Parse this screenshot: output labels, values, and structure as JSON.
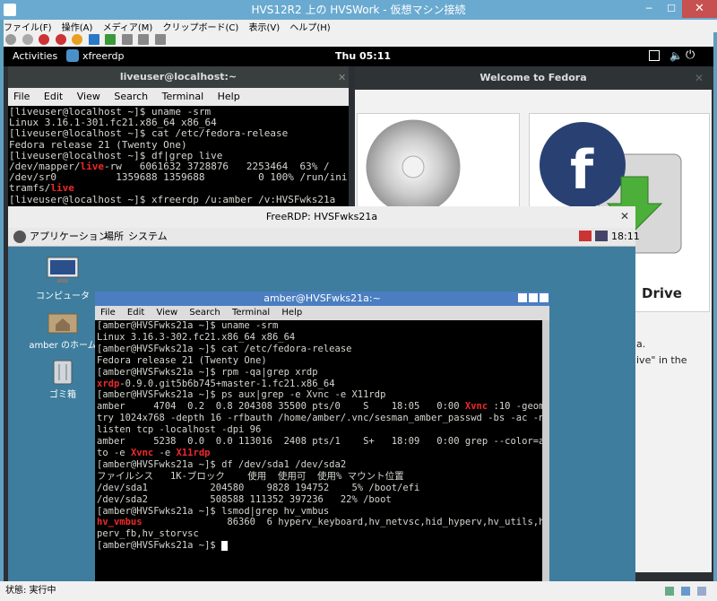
{
  "hyperv": {
    "title": "HVS12R2 上の HVSWork - 仮想マシン接続",
    "menu": [
      "ファイル(F)",
      "操作(A)",
      "メディア(M)",
      "クリップボード(C)",
      "表示(V)",
      "ヘルプ(H)"
    ],
    "status": "状態: 実行中",
    "close_glyph": "✕",
    "min_glyph": "─",
    "max_glyph": "☐"
  },
  "gnome": {
    "activities": "Activities",
    "app_name": "xfreerdp",
    "clock": "Thu 05:11"
  },
  "welcome": {
    "title": "Welcome to Fedora",
    "drive_text": "Drive",
    "text1": "a.",
    "text2": "ive\" in the"
  },
  "live_terminal": {
    "title": "liveuser@localhost:~",
    "menu": [
      "File",
      "Edit",
      "View",
      "Search",
      "Terminal",
      "Help"
    ],
    "lines": [
      [
        {
          "t": "[liveuser@localhost ~]$ uname -srm"
        }
      ],
      [
        {
          "t": "Linux 3.16.1-301.fc21.x86_64 x86_64"
        }
      ],
      [
        {
          "t": "[liveuser@localhost ~]$ cat /etc/fedora-release"
        }
      ],
      [
        {
          "t": "Fedora release 21 (Twenty One)"
        }
      ],
      [
        {
          "t": "[liveuser@localhost ~]$ df|grep live"
        }
      ],
      [
        {
          "t": "/dev/mapper/"
        },
        {
          "t": "live",
          "r": 1
        },
        {
          "t": "-rw   6061632 3728876   2253464  63% /"
        }
      ],
      [
        {
          "t": "/dev/sr0          1359688 1359688         0 100% /run/ini"
        }
      ],
      [
        {
          "t": "tramfs/"
        },
        {
          "t": "live",
          "r": 1
        }
      ],
      [
        {
          "t": "[liveuser@localhost ~]$ xfreerdp /u:amber /v:HVSFwks21a"
        }
      ]
    ]
  },
  "freerdp": {
    "title": "FreeRDP: HVSFwks21a",
    "panel_menu": [
      "アプリケーション",
      "場所",
      "システム"
    ],
    "panel_clock": "18:11",
    "desktop_icons": [
      "コンピュータ",
      "amber のホーム",
      "ゴミ箱"
    ]
  },
  "amber_terminal": {
    "title": "amber@HVSFwks21a:~",
    "menu": [
      "File",
      "Edit",
      "View",
      "Search",
      "Terminal",
      "Help"
    ],
    "lines": [
      [
        {
          "t": "[amber@HVSFwks21a ~]$ uname -srm"
        }
      ],
      [
        {
          "t": "Linux 3.16.3-302.fc21.x86_64 x86_64"
        }
      ],
      [
        {
          "t": "[amber@HVSFwks21a ~]$ cat /etc/fedora-release"
        }
      ],
      [
        {
          "t": "Fedora release 21 (Twenty One)"
        }
      ],
      [
        {
          "t": "[amber@HVSFwks21a ~]$ rpm -qa|grep xrdp"
        }
      ],
      [
        {
          "t": "xrdp",
          "r": 1
        },
        {
          "t": "-0.9.0.git5b6b745+master-1.fc21.x86_64"
        }
      ],
      [
        {
          "t": "[amber@HVSFwks21a ~]$ ps aux|grep -e Xvnc -e X11rdp"
        }
      ],
      [
        {
          "t": "amber     4704  0.2  0.8 204308 35500 pts/0    S    18:05   0:00 "
        },
        {
          "t": "Xvnc",
          "r": 1
        },
        {
          "t": " :10 -geome"
        }
      ],
      [
        {
          "t": "try 1024x768 -depth 16 -rfbauth /home/amber/.vnc/sesman_amber_passwd -bs -ac -no"
        }
      ],
      [
        {
          "t": "listen tcp -localhost -dpi 96"
        }
      ],
      [
        {
          "t": "amber     5238  0.0  0.0 113016  2408 pts/1    S+   18:09   0:00 grep --color=au"
        }
      ],
      [
        {
          "t": "to -e "
        },
        {
          "t": "Xvnc",
          "r": 1
        },
        {
          "t": " -e "
        },
        {
          "t": "X11rdp",
          "r": 1
        }
      ],
      [
        {
          "t": "[amber@HVSFwks21a ~]$ df /dev/sda1 /dev/sda2"
        }
      ],
      [
        {
          "t": "ファイルシス   1K-ブロック    使用  使用可  使用% マウント位置"
        }
      ],
      [
        {
          "t": "/dev/sda1           204580    9828 194752    5% /boot/efi"
        }
      ],
      [
        {
          "t": "/dev/sda2           508588 111352 397236   22% /boot"
        }
      ],
      [
        {
          "t": "[amber@HVSFwks21a ~]$ lsmod|grep hv_vmbus"
        }
      ],
      [
        {
          "t": "hv_vmbus",
          "r": 1
        },
        {
          "t": "               86360  6 hyperv_keyboard,hv_netvsc,hid_hyperv,hv_utils,hy"
        }
      ],
      [
        {
          "t": "perv_fb,hv_storvsc"
        }
      ],
      [
        {
          "t": "[amber@HVSFwks21a ~]$ "
        }
      ]
    ]
  }
}
